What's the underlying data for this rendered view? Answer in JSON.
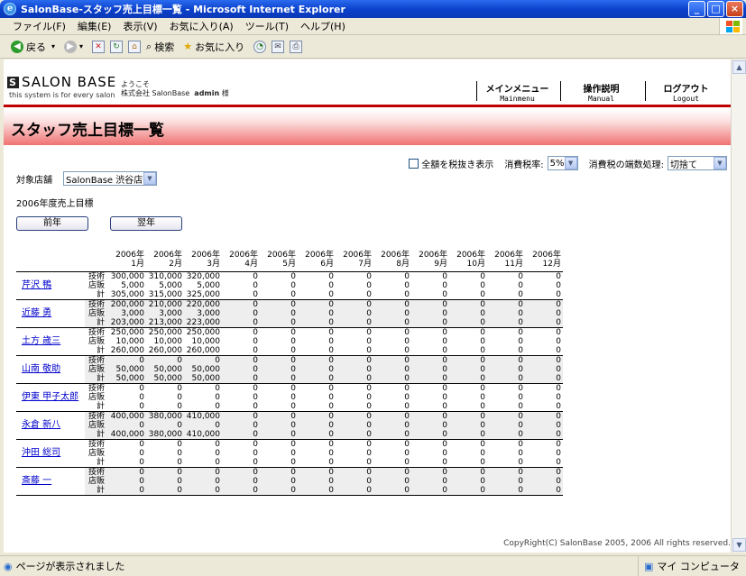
{
  "window": {
    "title": "SalonBase-スタッフ売上目標一覧 - Microsoft Internet Explorer",
    "min": "_",
    "max": "□",
    "close": "×"
  },
  "menu": [
    "ファイル(F)",
    "編集(E)",
    "表示(V)",
    "お気に入り(A)",
    "ツール(T)",
    "ヘルプ(H)"
  ],
  "toolbar": {
    "back": "戻る",
    "search": "検索",
    "favorites": "お気に入り"
  },
  "header": {
    "logo": "SALON BASE",
    "tagline": "this system is for every salon",
    "welcome": "ようこそ",
    "company": "株式会社 SalonBase",
    "user": "admin",
    "honorific": "様",
    "nav": [
      {
        "jp": "メインメニュー",
        "en": "Mainmenu"
      },
      {
        "jp": "操作説明",
        "en": "Manual"
      },
      {
        "jp": "ログアウト",
        "en": "Logout"
      }
    ]
  },
  "page_title": "スタッフ売上目標一覧",
  "options": {
    "tax_excluded_label": "全額を税抜き表示",
    "tax_rate_label": "消費税率:",
    "tax_rate_value": "5%",
    "rounding_label": "消費税の端数処理:",
    "rounding_value": "切捨て"
  },
  "store": {
    "label": "対象店舗",
    "value": "SalonBase 渋谷店"
  },
  "year_title": "2006年度売上目標",
  "buttons": {
    "prev": "前年",
    "next": "翌年"
  },
  "table": {
    "year": "2006年",
    "months": [
      "1月",
      "2月",
      "3月",
      "4月",
      "5月",
      "6月",
      "7月",
      "8月",
      "9月",
      "10月",
      "11月",
      "12月"
    ],
    "types": [
      "技術",
      "店販",
      "計"
    ],
    "staff": [
      {
        "name": "芹沢 鴨",
        "rows": [
          [
            "300,000",
            "310,000",
            "320,000",
            "0",
            "0",
            "0",
            "0",
            "0",
            "0",
            "0",
            "0",
            "0"
          ],
          [
            "5,000",
            "5,000",
            "5,000",
            "0",
            "0",
            "0",
            "0",
            "0",
            "0",
            "0",
            "0",
            "0"
          ],
          [
            "305,000",
            "315,000",
            "325,000",
            "0",
            "0",
            "0",
            "0",
            "0",
            "0",
            "0",
            "0",
            "0"
          ]
        ]
      },
      {
        "name": "近藤 勇",
        "rows": [
          [
            "200,000",
            "210,000",
            "220,000",
            "0",
            "0",
            "0",
            "0",
            "0",
            "0",
            "0",
            "0",
            "0"
          ],
          [
            "3,000",
            "3,000",
            "3,000",
            "0",
            "0",
            "0",
            "0",
            "0",
            "0",
            "0",
            "0",
            "0"
          ],
          [
            "203,000",
            "213,000",
            "223,000",
            "0",
            "0",
            "0",
            "0",
            "0",
            "0",
            "0",
            "0",
            "0"
          ]
        ]
      },
      {
        "name": "土方 歳三",
        "rows": [
          [
            "250,000",
            "250,000",
            "250,000",
            "0",
            "0",
            "0",
            "0",
            "0",
            "0",
            "0",
            "0",
            "0"
          ],
          [
            "10,000",
            "10,000",
            "10,000",
            "0",
            "0",
            "0",
            "0",
            "0",
            "0",
            "0",
            "0",
            "0"
          ],
          [
            "260,000",
            "260,000",
            "260,000",
            "0",
            "0",
            "0",
            "0",
            "0",
            "0",
            "0",
            "0",
            "0"
          ]
        ]
      },
      {
        "name": "山南 敬助",
        "rows": [
          [
            "0",
            "0",
            "0",
            "0",
            "0",
            "0",
            "0",
            "0",
            "0",
            "0",
            "0",
            "0"
          ],
          [
            "50,000",
            "50,000",
            "50,000",
            "0",
            "0",
            "0",
            "0",
            "0",
            "0",
            "0",
            "0",
            "0"
          ],
          [
            "50,000",
            "50,000",
            "50,000",
            "0",
            "0",
            "0",
            "0",
            "0",
            "0",
            "0",
            "0",
            "0"
          ]
        ]
      },
      {
        "name": "伊東 甲子太郎",
        "rows": [
          [
            "0",
            "0",
            "0",
            "0",
            "0",
            "0",
            "0",
            "0",
            "0",
            "0",
            "0",
            "0"
          ],
          [
            "0",
            "0",
            "0",
            "0",
            "0",
            "0",
            "0",
            "0",
            "0",
            "0",
            "0",
            "0"
          ],
          [
            "0",
            "0",
            "0",
            "0",
            "0",
            "0",
            "0",
            "0",
            "0",
            "0",
            "0",
            "0"
          ]
        ]
      },
      {
        "name": "永倉 新八",
        "rows": [
          [
            "400,000",
            "380,000",
            "410,000",
            "0",
            "0",
            "0",
            "0",
            "0",
            "0",
            "0",
            "0",
            "0"
          ],
          [
            "0",
            "0",
            "0",
            "0",
            "0",
            "0",
            "0",
            "0",
            "0",
            "0",
            "0",
            "0"
          ],
          [
            "400,000",
            "380,000",
            "410,000",
            "0",
            "0",
            "0",
            "0",
            "0",
            "0",
            "0",
            "0",
            "0"
          ]
        ]
      },
      {
        "name": "沖田 総司",
        "rows": [
          [
            "0",
            "0",
            "0",
            "0",
            "0",
            "0",
            "0",
            "0",
            "0",
            "0",
            "0",
            "0"
          ],
          [
            "0",
            "0",
            "0",
            "0",
            "0",
            "0",
            "0",
            "0",
            "0",
            "0",
            "0",
            "0"
          ],
          [
            "0",
            "0",
            "0",
            "0",
            "0",
            "0",
            "0",
            "0",
            "0",
            "0",
            "0",
            "0"
          ]
        ]
      },
      {
        "name": "斎藤 一",
        "rows": [
          [
            "0",
            "0",
            "0",
            "0",
            "0",
            "0",
            "0",
            "0",
            "0",
            "0",
            "0",
            "0"
          ],
          [
            "0",
            "0",
            "0",
            "0",
            "0",
            "0",
            "0",
            "0",
            "0",
            "0",
            "0",
            "0"
          ],
          [
            "0",
            "0",
            "0",
            "0",
            "0",
            "0",
            "0",
            "0",
            "0",
            "0",
            "0",
            "0"
          ]
        ]
      }
    ]
  },
  "copyright": "CopyRight(C) SalonBase 2005, 2006 All rights reserved.",
  "status": {
    "text": "ページが表示されました",
    "zone": "マイ コンピュータ"
  }
}
